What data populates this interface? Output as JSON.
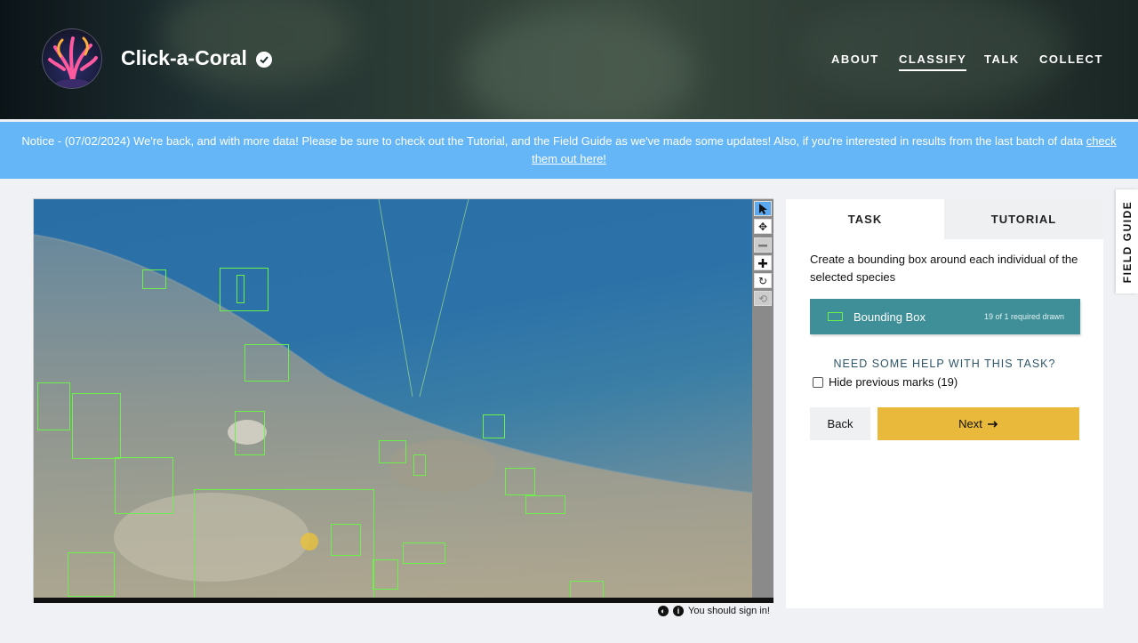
{
  "header": {
    "title": "Click-a-Coral",
    "nav": [
      "ABOUT",
      "CLASSIFY",
      "TALK",
      "COLLECT"
    ],
    "active_nav": "CLASSIFY"
  },
  "notice": {
    "text": "Notice - (07/02/2024) We're back, and with more data! Please be sure to check out the Tutorial, and the Field Guide as we've made some updates! Also, if you're interested in results from the last batch of data",
    "link": "check them out here!"
  },
  "viewer": {
    "tools": [
      "pointer-icon",
      "move-icon",
      "zoom-out-icon",
      "zoom-in-icon",
      "rotate-icon",
      "reset-icon"
    ],
    "signin_text": "You should sign in!",
    "mark_color": "#6cf04a",
    "mark_count": 19
  },
  "panel": {
    "tabs": {
      "task": "TASK",
      "tutorial": "TUTORIAL"
    },
    "instruction": "Create a bounding box around each individual of the selected species",
    "tool": {
      "label": "Bounding Box",
      "count": "19 of 1 required drawn"
    },
    "help": "NEED SOME HELP WITH THIS TASK?",
    "hide_marks": "Hide previous marks (19)",
    "back": "Back",
    "next": "Next",
    "accent_color": "#3e8f97",
    "next_color": "#e8b93a"
  },
  "field_guide": "FIELD GUIDE"
}
